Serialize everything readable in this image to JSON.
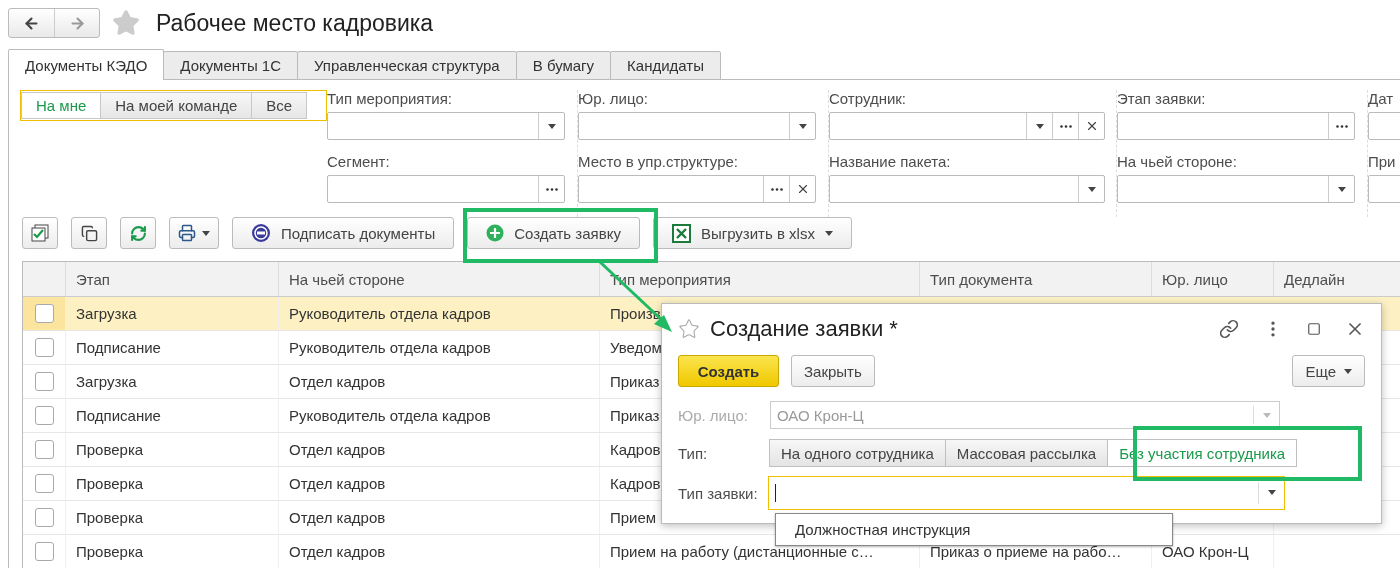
{
  "header": {
    "title": "Рабочее место кадровика"
  },
  "tabs": [
    {
      "label": "Документы КЭДО",
      "selected": true
    },
    {
      "label": "Документы 1С",
      "selected": false
    },
    {
      "label": "Управленческая структура",
      "selected": false
    },
    {
      "label": "В бумагу",
      "selected": false
    },
    {
      "label": "Кандидаты",
      "selected": false
    }
  ],
  "filters": {
    "scope": [
      {
        "label": "На мне",
        "selected": true
      },
      {
        "label": "На моей команде",
        "selected": false
      },
      {
        "label": "Все",
        "selected": false
      }
    ],
    "columns": [
      [
        {
          "label": "Тип мероприятия:",
          "buttons": [
            {
              "kind": "dropdown"
            }
          ]
        },
        {
          "label": "Сегмент:",
          "buttons": [
            {
              "kind": "choose"
            }
          ]
        }
      ],
      [
        {
          "label": "Юр. лицо:",
          "buttons": [
            {
              "kind": "dropdown"
            }
          ]
        },
        {
          "label": "Место в упр.структуре:",
          "buttons": [
            {
              "kind": "choose"
            },
            {
              "kind": "clear"
            }
          ]
        }
      ],
      [
        {
          "label": "Сотрудник:",
          "buttons": [
            {
              "kind": "dropdown"
            },
            {
              "kind": "choose"
            },
            {
              "kind": "clear"
            }
          ]
        },
        {
          "label": "Название пакета:",
          "buttons": [
            {
              "kind": "dropdown"
            }
          ]
        }
      ],
      [
        {
          "label": "Этап заявки:",
          "buttons": [
            {
              "kind": "choose"
            }
          ]
        },
        {
          "label": "На чьей стороне:",
          "buttons": [
            {
              "kind": "dropdown"
            }
          ]
        }
      ],
      [
        {
          "label": "Дат"
        },
        {
          "label": "При"
        }
      ]
    ]
  },
  "toolbar": [
    {
      "kind": "mark-all"
    },
    {
      "kind": "copy"
    },
    {
      "kind": "refresh"
    },
    {
      "kind": "print"
    },
    {
      "kind": "sign",
      "label": "Подписать документы"
    },
    {
      "kind": "create",
      "label": "Создать заявку"
    },
    {
      "kind": "export",
      "label": "Выгрузить в xlsx"
    }
  ],
  "table": {
    "columns": [
      "Этап",
      "На чьей стороне",
      "Тип мероприятия",
      "Тип документа",
      "Юр. лицо",
      "Дедлайн"
    ],
    "rows": [
      {
        "selected": true,
        "checked": false,
        "cells": [
          "Загрузка",
          "Руководитель отдела кадров",
          "Произв"
        ]
      },
      {
        "selected": false,
        "checked": false,
        "cells": [
          "Подписание",
          "Руководитель отдела кадров",
          "Уведом"
        ]
      },
      {
        "selected": false,
        "checked": false,
        "cells": [
          "Загрузка",
          "Отдел кадров",
          "Приказ"
        ]
      },
      {
        "selected": false,
        "checked": false,
        "cells": [
          "Подписание",
          "Руководитель отдела кадров",
          "Приказ"
        ]
      },
      {
        "selected": false,
        "checked": false,
        "cells": [
          "Проверка",
          "Отдел кадров",
          "Кадров"
        ]
      },
      {
        "selected": false,
        "checked": false,
        "cells": [
          "Проверка",
          "Отдел кадров",
          "Кадров"
        ]
      },
      {
        "selected": false,
        "checked": false,
        "cells": [
          "Проверка",
          "Отдел кадров",
          "Прием"
        ]
      },
      {
        "selected": false,
        "checked": false,
        "cells": [
          "Проверка",
          "Отдел кадров",
          "Прием на работу (дистанционные с…",
          "Приказ о приеме на рабо…",
          "ОАО Крон-Ц"
        ]
      }
    ]
  },
  "dialog": {
    "title": "Создание заявки *",
    "create_button": "Создать",
    "close_button": "Закрыть",
    "more_button": "Еще",
    "legal_entity": {
      "label": "Юр. лицо:",
      "value": "ОАО Крон-Ц",
      "disabled": true
    },
    "type": {
      "label": "Тип:",
      "options": [
        {
          "label": "На одного сотрудника",
          "selected": false
        },
        {
          "label": "Массовая рассылка",
          "selected": false
        },
        {
          "label": "Без участия сотрудника",
          "selected": true
        }
      ]
    },
    "request_type": {
      "label": "Тип заявки:",
      "focused": true
    },
    "suggestions": [
      "Должностная инструкция"
    ]
  }
}
